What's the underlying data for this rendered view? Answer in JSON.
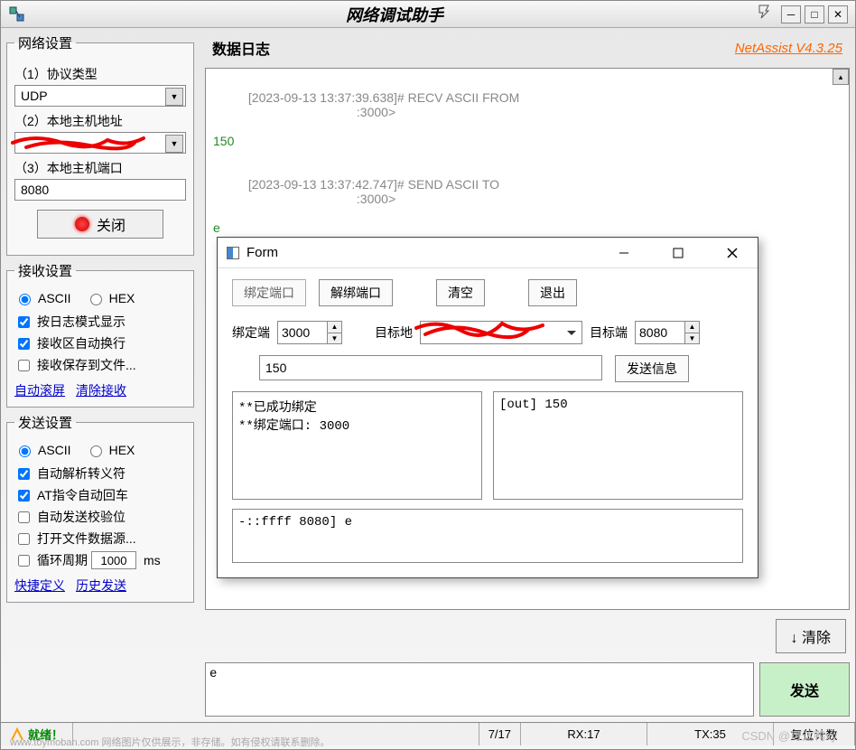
{
  "window": {
    "title": "网络调试助手"
  },
  "version": "NetAssist V4.3.25",
  "network_settings": {
    "legend": "网络设置",
    "protocol_label": "（1）协议类型",
    "protocol": "UDP",
    "host_addr_label": "（2）本地主机地址",
    "host_addr": "",
    "host_port_label": "（3）本地主机端口",
    "host_port": "8080",
    "close_label": "关闭"
  },
  "recv_settings": {
    "legend": "接收设置",
    "ascii": "ASCII",
    "hex": "HEX",
    "log_mode": "按日志模式显示",
    "auto_wrap": "接收区自动换行",
    "save_file": "接收保存到文件...",
    "auto_scroll": "自动滚屏",
    "clear_recv": "清除接收"
  },
  "send_settings": {
    "legend": "发送设置",
    "ascii": "ASCII",
    "hex": "HEX",
    "auto_escape": "自动解析转义符",
    "at_return": "AT指令自动回车",
    "auto_check": "自动发送校验位",
    "open_file": "打开文件数据源...",
    "loop_period": "循环周期",
    "period_value": "1000",
    "period_unit": "ms",
    "shortcut": "快捷定义",
    "history": "历史发送"
  },
  "log": {
    "title": "数据日志",
    "line1_header": "[2023-09-13 13:37:39.638]# RECV ASCII FROM",
    "line1_addr": ":3000>",
    "line1_data": "150",
    "line2_header": "[2023-09-13 13:37:42.747]# SEND ASCII TO",
    "line2_addr": ":3000>",
    "line2_data": "e"
  },
  "send_box": {
    "content": "e",
    "clear": "清除",
    "send": "发送"
  },
  "status": {
    "ready": "就绪！",
    "progress": "7/17",
    "rx": "RX:17",
    "tx": "TX:35",
    "reset": "复位计数"
  },
  "dialog": {
    "title": "Form",
    "btn_bind": "绑定端口",
    "btn_unbind": "解绑端口",
    "btn_clear": "清空",
    "btn_exit": "退出",
    "bind_port_label": "绑定端",
    "bind_port": "3000",
    "target_addr_label": "目标地",
    "target_addr": "",
    "target_port_label": "目标端",
    "target_port": "8080",
    "msg_value": "150",
    "btn_send_info": "发送信息",
    "log_left": "**已成功绑定\n**绑定端口: 3000",
    "log_right": "[out] 150",
    "bottom_text": "-::ffff           8080] e"
  },
  "footer": "www.toymoban.com 网络图片仅供展示，非存储。如有侵权请联系删除。",
  "csdn": "CSDN @可达鸭xy"
}
